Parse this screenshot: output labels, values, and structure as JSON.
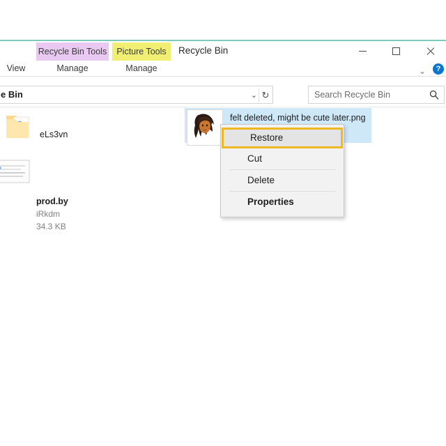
{
  "window": {
    "title": "Recycle Bin",
    "accent_rule_color": "#7fc7bd",
    "controls": {
      "minimize_label": "Minimize",
      "maximize_label": "Maximize",
      "close_label": "Close",
      "collapse_ribbon_label": "⌄",
      "help_label": "?"
    }
  },
  "ribbon": {
    "contextual_tabs": [
      {
        "label": "Recycle Bin Tools",
        "color": "#e9c9f2",
        "sub_label": "Manage"
      },
      {
        "label": "Picture Tools",
        "color": "#f0ef73",
        "sub_label": "Manage"
      }
    ],
    "tabs": [
      {
        "label": "View"
      },
      {
        "label": "Manage"
      },
      {
        "label": "Manage"
      }
    ]
  },
  "navigation": {
    "address_value": "e Bin",
    "address_dropdown_glyph": "⌄",
    "refresh_glyph": "↻"
  },
  "search": {
    "placeholder": "Search Recycle Bin",
    "icon_name": "search-icon"
  },
  "files": {
    "items": [
      {
        "name": "eLs3vn",
        "icon": "folder-icon",
        "author": "",
        "size": ""
      },
      {
        "name": "prod.by",
        "icon": "document-icon",
        "author": "iRkdm",
        "size": "34.3 KB"
      }
    ],
    "selected": {
      "name": "felt deleted, might be cute later.png",
      "icon": "image-thumbnail-avatar",
      "selection_color": "#cfe8f8"
    }
  },
  "context_menu": {
    "highlight_color": "#f0b820",
    "items": [
      {
        "label": "Restore",
        "highlighted": true,
        "bold": false,
        "separator_after": false
      },
      {
        "label": "Cut",
        "highlighted": false,
        "bold": false,
        "separator_after": true
      },
      {
        "label": "Delete",
        "highlighted": false,
        "bold": false,
        "separator_after": true
      },
      {
        "label": "Properties",
        "highlighted": false,
        "bold": true,
        "separator_after": false
      }
    ]
  }
}
